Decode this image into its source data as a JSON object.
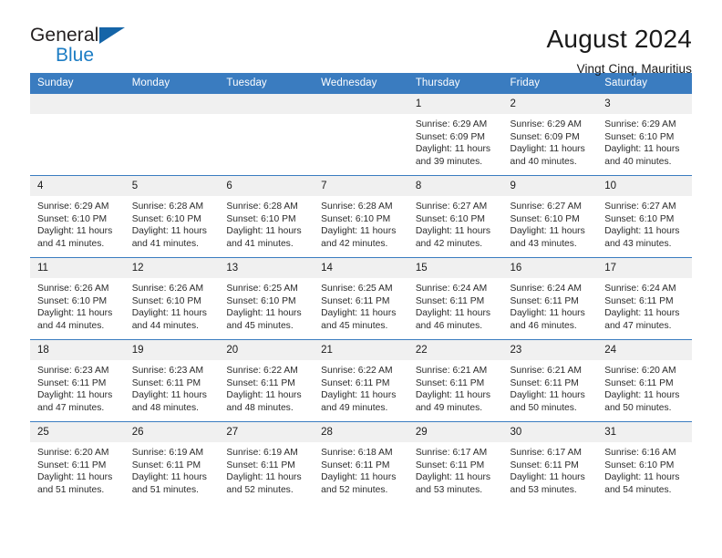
{
  "brand": {
    "line1": "General",
    "line2": "Blue",
    "triangle_color": "#1565a8",
    "blue_color": "#1d7dc4"
  },
  "header": {
    "title": "August 2024",
    "subtitle": "Vingt Cinq, Mauritius",
    "accent_color": "#3a7cc0"
  },
  "weekdays": [
    "Sunday",
    "Monday",
    "Tuesday",
    "Wednesday",
    "Thursday",
    "Friday",
    "Saturday"
  ],
  "weeks": [
    [
      {
        "day": "",
        "lines": []
      },
      {
        "day": "",
        "lines": []
      },
      {
        "day": "",
        "lines": []
      },
      {
        "day": "",
        "lines": []
      },
      {
        "day": "1",
        "lines": [
          "Sunrise: 6:29 AM",
          "Sunset: 6:09 PM",
          "Daylight: 11 hours",
          "and 39 minutes."
        ]
      },
      {
        "day": "2",
        "lines": [
          "Sunrise: 6:29 AM",
          "Sunset: 6:09 PM",
          "Daylight: 11 hours",
          "and 40 minutes."
        ]
      },
      {
        "day": "3",
        "lines": [
          "Sunrise: 6:29 AM",
          "Sunset: 6:10 PM",
          "Daylight: 11 hours",
          "and 40 minutes."
        ]
      }
    ],
    [
      {
        "day": "4",
        "lines": [
          "Sunrise: 6:29 AM",
          "Sunset: 6:10 PM",
          "Daylight: 11 hours",
          "and 41 minutes."
        ]
      },
      {
        "day": "5",
        "lines": [
          "Sunrise: 6:28 AM",
          "Sunset: 6:10 PM",
          "Daylight: 11 hours",
          "and 41 minutes."
        ]
      },
      {
        "day": "6",
        "lines": [
          "Sunrise: 6:28 AM",
          "Sunset: 6:10 PM",
          "Daylight: 11 hours",
          "and 41 minutes."
        ]
      },
      {
        "day": "7",
        "lines": [
          "Sunrise: 6:28 AM",
          "Sunset: 6:10 PM",
          "Daylight: 11 hours",
          "and 42 minutes."
        ]
      },
      {
        "day": "8",
        "lines": [
          "Sunrise: 6:27 AM",
          "Sunset: 6:10 PM",
          "Daylight: 11 hours",
          "and 42 minutes."
        ]
      },
      {
        "day": "9",
        "lines": [
          "Sunrise: 6:27 AM",
          "Sunset: 6:10 PM",
          "Daylight: 11 hours",
          "and 43 minutes."
        ]
      },
      {
        "day": "10",
        "lines": [
          "Sunrise: 6:27 AM",
          "Sunset: 6:10 PM",
          "Daylight: 11 hours",
          "and 43 minutes."
        ]
      }
    ],
    [
      {
        "day": "11",
        "lines": [
          "Sunrise: 6:26 AM",
          "Sunset: 6:10 PM",
          "Daylight: 11 hours",
          "and 44 minutes."
        ]
      },
      {
        "day": "12",
        "lines": [
          "Sunrise: 6:26 AM",
          "Sunset: 6:10 PM",
          "Daylight: 11 hours",
          "and 44 minutes."
        ]
      },
      {
        "day": "13",
        "lines": [
          "Sunrise: 6:25 AM",
          "Sunset: 6:10 PM",
          "Daylight: 11 hours",
          "and 45 minutes."
        ]
      },
      {
        "day": "14",
        "lines": [
          "Sunrise: 6:25 AM",
          "Sunset: 6:11 PM",
          "Daylight: 11 hours",
          "and 45 minutes."
        ]
      },
      {
        "day": "15",
        "lines": [
          "Sunrise: 6:24 AM",
          "Sunset: 6:11 PM",
          "Daylight: 11 hours",
          "and 46 minutes."
        ]
      },
      {
        "day": "16",
        "lines": [
          "Sunrise: 6:24 AM",
          "Sunset: 6:11 PM",
          "Daylight: 11 hours",
          "and 46 minutes."
        ]
      },
      {
        "day": "17",
        "lines": [
          "Sunrise: 6:24 AM",
          "Sunset: 6:11 PM",
          "Daylight: 11 hours",
          "and 47 minutes."
        ]
      }
    ],
    [
      {
        "day": "18",
        "lines": [
          "Sunrise: 6:23 AM",
          "Sunset: 6:11 PM",
          "Daylight: 11 hours",
          "and 47 minutes."
        ]
      },
      {
        "day": "19",
        "lines": [
          "Sunrise: 6:23 AM",
          "Sunset: 6:11 PM",
          "Daylight: 11 hours",
          "and 48 minutes."
        ]
      },
      {
        "day": "20",
        "lines": [
          "Sunrise: 6:22 AM",
          "Sunset: 6:11 PM",
          "Daylight: 11 hours",
          "and 48 minutes."
        ]
      },
      {
        "day": "21",
        "lines": [
          "Sunrise: 6:22 AM",
          "Sunset: 6:11 PM",
          "Daylight: 11 hours",
          "and 49 minutes."
        ]
      },
      {
        "day": "22",
        "lines": [
          "Sunrise: 6:21 AM",
          "Sunset: 6:11 PM",
          "Daylight: 11 hours",
          "and 49 minutes."
        ]
      },
      {
        "day": "23",
        "lines": [
          "Sunrise: 6:21 AM",
          "Sunset: 6:11 PM",
          "Daylight: 11 hours",
          "and 50 minutes."
        ]
      },
      {
        "day": "24",
        "lines": [
          "Sunrise: 6:20 AM",
          "Sunset: 6:11 PM",
          "Daylight: 11 hours",
          "and 50 minutes."
        ]
      }
    ],
    [
      {
        "day": "25",
        "lines": [
          "Sunrise: 6:20 AM",
          "Sunset: 6:11 PM",
          "Daylight: 11 hours",
          "and 51 minutes."
        ]
      },
      {
        "day": "26",
        "lines": [
          "Sunrise: 6:19 AM",
          "Sunset: 6:11 PM",
          "Daylight: 11 hours",
          "and 51 minutes."
        ]
      },
      {
        "day": "27",
        "lines": [
          "Sunrise: 6:19 AM",
          "Sunset: 6:11 PM",
          "Daylight: 11 hours",
          "and 52 minutes."
        ]
      },
      {
        "day": "28",
        "lines": [
          "Sunrise: 6:18 AM",
          "Sunset: 6:11 PM",
          "Daylight: 11 hours",
          "and 52 minutes."
        ]
      },
      {
        "day": "29",
        "lines": [
          "Sunrise: 6:17 AM",
          "Sunset: 6:11 PM",
          "Daylight: 11 hours",
          "and 53 minutes."
        ]
      },
      {
        "day": "30",
        "lines": [
          "Sunrise: 6:17 AM",
          "Sunset: 6:11 PM",
          "Daylight: 11 hours",
          "and 53 minutes."
        ]
      },
      {
        "day": "31",
        "lines": [
          "Sunrise: 6:16 AM",
          "Sunset: 6:10 PM",
          "Daylight: 11 hours",
          "and 54 minutes."
        ]
      }
    ]
  ]
}
